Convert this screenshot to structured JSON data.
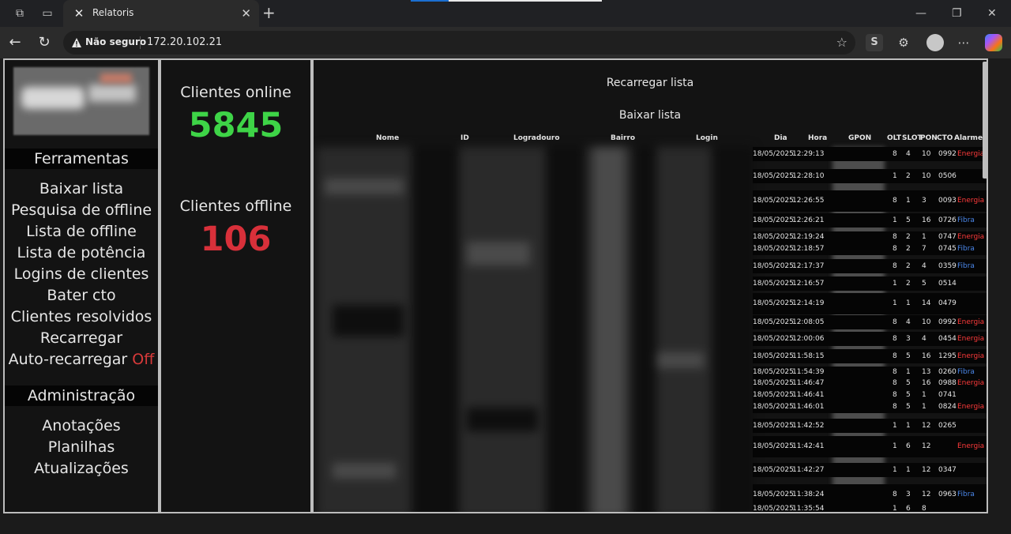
{
  "browser": {
    "tab_title": "Relatoris",
    "security_label": "Não seguro",
    "url": "172.20.102.21",
    "extension_label": "S"
  },
  "menu": {
    "tools_header": "Ferramentas",
    "tools": [
      "Baixar lista",
      "Pesquisa de offline",
      "Lista de offline",
      "Lista de potência",
      "Logins de clientes",
      "Bater cto",
      "Clientes resolvidos",
      "Recarregar"
    ],
    "auto_reload_label": "Auto-recarregar",
    "auto_reload_state": "Off",
    "admin_header": "Administração",
    "admin": [
      "Anotações",
      "Planilhas",
      "Atualizações"
    ]
  },
  "stats": {
    "online_label": "Clientes online",
    "online_value": "5845",
    "offline_label": "Clientes offline",
    "offline_value": "106"
  },
  "colors": {
    "online": "#3ed447",
    "offline": "#d8303a",
    "energia": "#ff3b3b",
    "fibra": "#4a86e8"
  },
  "list": {
    "reload_label": "Recarregar lista",
    "download_label": "Baixar lista",
    "columns": [
      "Nome",
      "ID",
      "Logradouro",
      "Bairro",
      "Login",
      "Dia",
      "Hora",
      "GPON",
      "OLT",
      "SLOT",
      "PON",
      "CTO",
      "Alarme"
    ],
    "rows": [
      {
        "dia": "18/05/2025",
        "hora": "12:29:13",
        "olt": "8",
        "slot": "4",
        "pon": "10",
        "cto": "0992",
        "alarme": "Energia"
      },
      {
        "dia": "18/05/2025",
        "hora": "12:28:10",
        "olt": "1",
        "slot": "2",
        "pon": "10",
        "cto": "0506",
        "alarme": ""
      },
      {
        "dia": "18/05/2025",
        "hora": "12:26:55",
        "olt": "8",
        "slot": "1",
        "pon": "3",
        "cto": "0093",
        "alarme": "Energia"
      },
      {
        "dia": "18/05/2025",
        "hora": "12:26:21",
        "olt": "1",
        "slot": "5",
        "pon": "16",
        "cto": "0726",
        "alarme": "Fibra"
      },
      {
        "dia": "18/05/2025",
        "hora": "12:19:24",
        "olt": "8",
        "slot": "2",
        "pon": "1",
        "cto": "0747",
        "alarme": "Energia"
      },
      {
        "dia": "18/05/2025",
        "hora": "12:18:57",
        "olt": "8",
        "slot": "2",
        "pon": "7",
        "cto": "0745",
        "alarme": "Fibra"
      },
      {
        "dia": "18/05/2025",
        "hora": "12:17:37",
        "olt": "8",
        "slot": "2",
        "pon": "4",
        "cto": "0359",
        "alarme": "Fibra"
      },
      {
        "dia": "18/05/2025",
        "hora": "12:16:57",
        "olt": "1",
        "slot": "2",
        "pon": "5",
        "cto": "0514",
        "alarme": ""
      },
      {
        "dia": "18/05/2025",
        "hora": "12:14:19",
        "olt": "1",
        "slot": "1",
        "pon": "14",
        "cto": "0479",
        "alarme": ""
      },
      {
        "dia": "18/05/2025",
        "hora": "12:08:05",
        "olt": "8",
        "slot": "4",
        "pon": "10",
        "cto": "0992",
        "alarme": "Energia"
      },
      {
        "dia": "18/05/2025",
        "hora": "12:00:06",
        "olt": "8",
        "slot": "3",
        "pon": "4",
        "cto": "0454",
        "alarme": "Energia"
      },
      {
        "dia": "18/05/2025",
        "hora": "11:58:15",
        "olt": "8",
        "slot": "5",
        "pon": "16",
        "cto": "1295",
        "alarme": "Energia"
      },
      {
        "dia": "18/05/2025",
        "hora": "11:54:39",
        "olt": "8",
        "slot": "1",
        "pon": "13",
        "cto": "0260",
        "alarme": "Fibra"
      },
      {
        "dia": "18/05/2025",
        "hora": "11:46:47",
        "olt": "8",
        "slot": "5",
        "pon": "16",
        "cto": "0988",
        "alarme": "Energia"
      },
      {
        "dia": "18/05/2025",
        "hora": "11:46:41",
        "olt": "8",
        "slot": "5",
        "pon": "1",
        "cto": "0741",
        "alarme": ""
      },
      {
        "dia": "18/05/2025",
        "hora": "11:46:01",
        "olt": "8",
        "slot": "5",
        "pon": "1",
        "cto": "0824",
        "alarme": "Energia"
      },
      {
        "dia": "18/05/2025",
        "hora": "11:42:52",
        "olt": "1",
        "slot": "1",
        "pon": "12",
        "cto": "0265",
        "alarme": ""
      },
      {
        "dia": "18/05/2025",
        "hora": "11:42:41",
        "olt": "1",
        "slot": "6",
        "pon": "12",
        "cto": "",
        "alarme": "Energia"
      },
      {
        "dia": "18/05/2025",
        "hora": "11:42:27",
        "olt": "1",
        "slot": "1",
        "pon": "12",
        "cto": "0347",
        "alarme": ""
      },
      {
        "dia": "18/05/2025",
        "hora": "11:38:24",
        "olt": "8",
        "slot": "3",
        "pon": "12",
        "cto": "0963",
        "alarme": "Fibra"
      },
      {
        "dia": "18/05/2025",
        "hora": "11:35:54",
        "olt": "1",
        "slot": "6",
        "pon": "8",
        "cto": "",
        "alarme": ""
      }
    ]
  }
}
